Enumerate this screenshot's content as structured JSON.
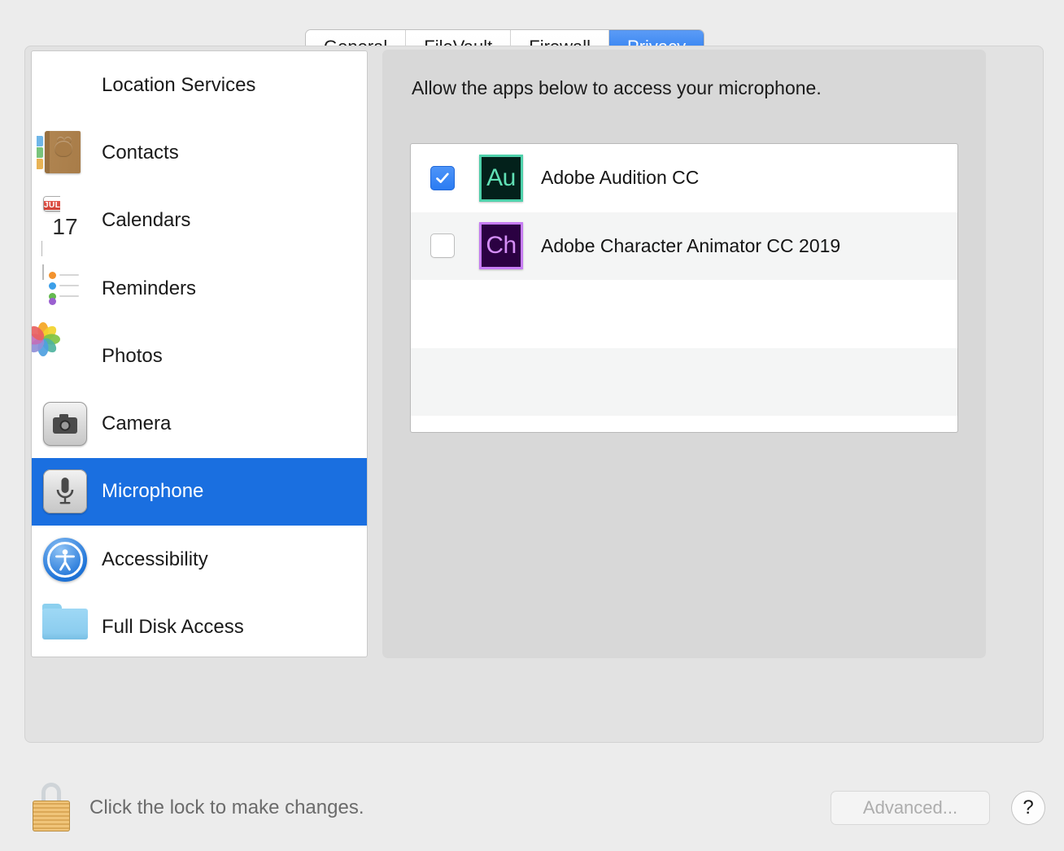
{
  "tabs": [
    {
      "label": "General",
      "selected": false
    },
    {
      "label": "FileVault",
      "selected": false
    },
    {
      "label": "Firewall",
      "selected": false
    },
    {
      "label": "Privacy",
      "selected": true
    }
  ],
  "sidebar": {
    "items": [
      {
        "label": "Location Services",
        "icon": "location-services-icon",
        "selected": false
      },
      {
        "label": "Contacts",
        "icon": "contacts-icon",
        "selected": false
      },
      {
        "label": "Calendars",
        "icon": "calendars-icon",
        "selected": false
      },
      {
        "label": "Reminders",
        "icon": "reminders-icon",
        "selected": false
      },
      {
        "label": "Photos",
        "icon": "photos-icon",
        "selected": false
      },
      {
        "label": "Camera",
        "icon": "camera-icon",
        "selected": false
      },
      {
        "label": "Microphone",
        "icon": "microphone-icon",
        "selected": true
      },
      {
        "label": "Accessibility",
        "icon": "accessibility-icon",
        "selected": false
      },
      {
        "label": "Full Disk Access",
        "icon": "folder-icon",
        "selected": false
      }
    ],
    "calendar_icon": {
      "month": "JUL",
      "day": "17"
    }
  },
  "main": {
    "title": "Allow the apps below to access your microphone.",
    "apps": [
      {
        "name": "Adobe Audition CC",
        "checked": true,
        "icon_text": "Au",
        "icon_bg": "#03211B",
        "icon_border": "#4FD1AB",
        "icon_fg": "#60E0B5"
      },
      {
        "name": "Adobe Character Animator CC 2019",
        "checked": false,
        "icon_text": "Ch",
        "icon_bg": "#2B0142",
        "icon_border": "#C77DF5",
        "icon_fg": "#D58FF7"
      }
    ],
    "empty_rows": 3
  },
  "footer": {
    "lock_message": "Click the lock to make changes.",
    "advanced_label": "Advanced...",
    "help_label": "?"
  },
  "colors": {
    "accent_blue": "#1a6fe0",
    "tab_selected_blue": "#2176f0",
    "window_bg": "#ececec",
    "panel_bg": "#e2e2e2",
    "right_pane_bg": "#d8d8d8",
    "list_alt_row": "#f4f5f5"
  }
}
